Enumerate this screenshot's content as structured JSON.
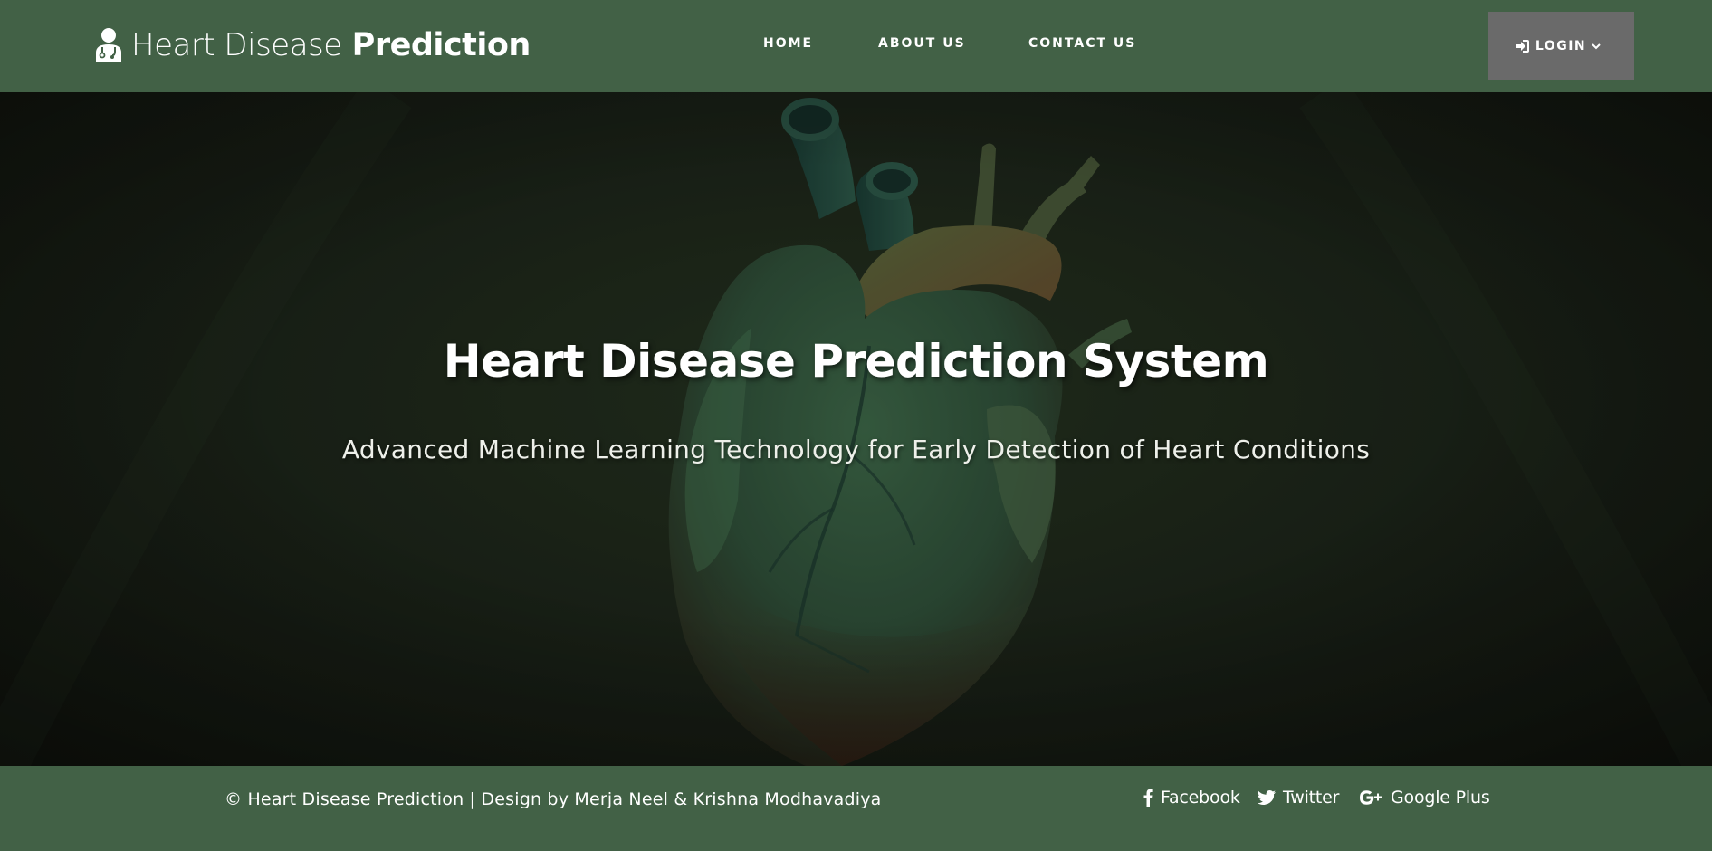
{
  "navbar": {
    "brand_light": "Heart Disease",
    "brand_bold": "Prediction",
    "brand_icon": "doctor-icon",
    "links": [
      {
        "label": "HOME"
      },
      {
        "label": "ABOUT US"
      },
      {
        "label": "CONTACT US"
      }
    ],
    "login_label": "LOGIN",
    "login_icon": "sign-in-icon",
    "login_caret": "chevron-down-icon"
  },
  "hero": {
    "title": "Heart Disease Prediction System",
    "subtitle": "Advanced Machine Learning Technology for Early Detection of Heart Conditions",
    "background_image": "anatomical-heart-illustration"
  },
  "footer": {
    "copyright": "© Heart Disease Prediction | Design by Merja Neel & Krishna Modhavadiya",
    "social": [
      {
        "label": "Facebook",
        "icon": "facebook-icon"
      },
      {
        "label": "Twitter",
        "icon": "twitter-icon"
      },
      {
        "label": "Google Plus",
        "icon": "google-plus-icon"
      }
    ]
  },
  "colors": {
    "navbar_bg": "#426146",
    "footer_bg": "#426146",
    "login_bg": "#6a6a6a",
    "hero_bg": "#1b1f16",
    "text": "#ffffff"
  }
}
